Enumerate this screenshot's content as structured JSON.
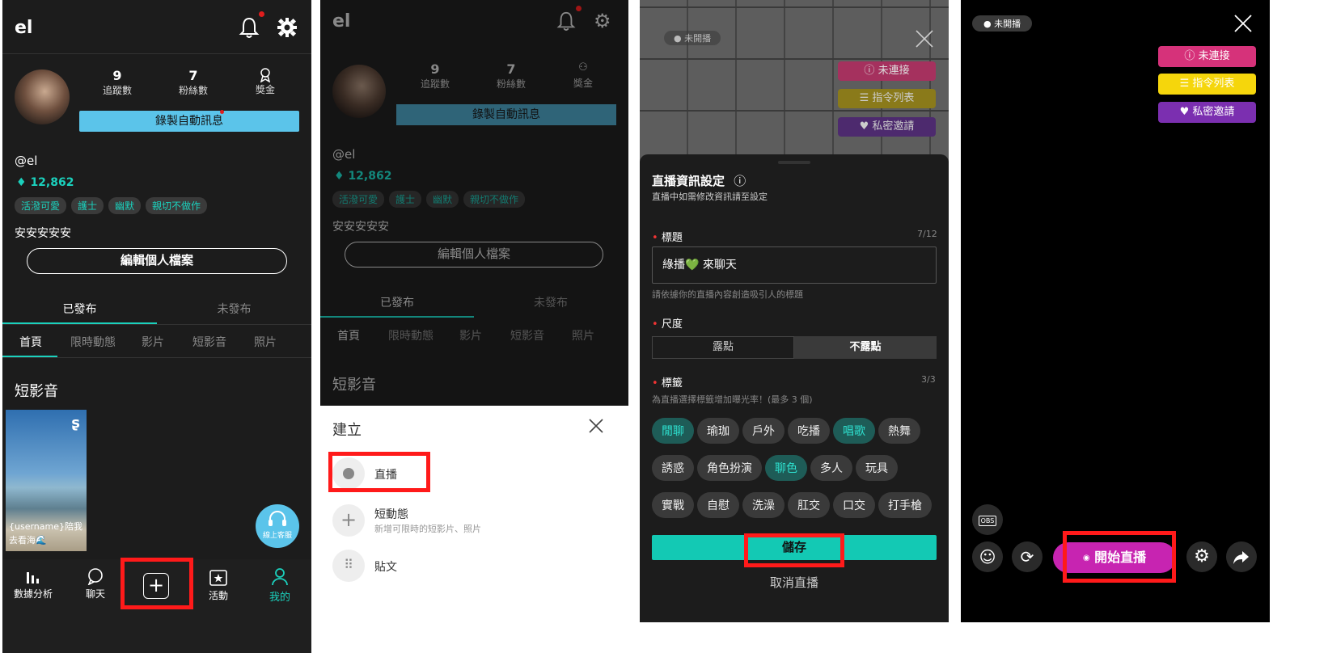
{
  "profile": {
    "app_title": "el",
    "stats": [
      {
        "value": "9",
        "label": "追蹤數"
      },
      {
        "value": "7",
        "label": "粉絲數"
      },
      {
        "value": "",
        "label": "獎金"
      }
    ],
    "record_button": "錄製自動訊息",
    "handle": "@el",
    "diamonds": "12,862",
    "tags": [
      "活潑可愛",
      "護士",
      "幽默",
      "親切不做作"
    ],
    "bio": "安安安安安",
    "edit_button": "編輯個人檔案",
    "tabs": [
      "已發布",
      "未發布"
    ],
    "subtabs": [
      "首頁",
      "限時動態",
      "影片",
      "短影音",
      "照片"
    ],
    "section_title": "短影音",
    "thumb_caption": "{username}陪我去看海🌊",
    "support_label": "線上客服",
    "nav": [
      "數據分析",
      "聊天",
      "",
      "活動",
      "我的"
    ]
  },
  "create_sheet": {
    "title": "建立",
    "items": [
      {
        "label": "直播",
        "sub": ""
      },
      {
        "label": "短動態",
        "sub": "新增可限時的短影片、照片"
      },
      {
        "label": "貼文",
        "sub": ""
      }
    ]
  },
  "live_settings": {
    "status": "未開播",
    "side_buttons": [
      "未連接",
      "指令列表",
      "私密邀請"
    ],
    "heading": "直播資訊設定",
    "subheading": "直播中如需修改資訊請至設定",
    "title_label": "標題",
    "title_count": "7/12",
    "title_value": "綠播💚 來聊天",
    "title_hint": "請依據你的直播內容創造吸引人的標題",
    "level_label": "尺度",
    "level_options": [
      "露點",
      "不露點"
    ],
    "tags_label": "標籤",
    "tags_count": "3/3",
    "tags_hint": "為直播選擇標籤增加曝光率！(最多 3 個)",
    "tags": [
      "閒聊",
      "瑜珈",
      "戶外",
      "吃播",
      "唱歌",
      "熱舞",
      "誘惑",
      "角色扮演",
      "聊色",
      "多人",
      "玩具",
      "實戰",
      "自慰",
      "洗澡",
      "肛交",
      "口交",
      "打手槍"
    ],
    "selected_tags": [
      "閒聊",
      "唱歌",
      "聊色"
    ],
    "save_button": "儲存",
    "cancel_link": "取消直播"
  },
  "live_preview": {
    "status": "未開播",
    "side_buttons": [
      "未連接",
      "指令列表",
      "私密邀請"
    ],
    "obs_label": "OBS",
    "start_button": "開始直播"
  },
  "colors": {
    "accent": "#1bd1bd",
    "record_btn": "#5bc4ea",
    "pink": "#d6327a",
    "yellow": "#f5d60c",
    "purple": "#7b2fb0",
    "start": "#c724b1"
  }
}
